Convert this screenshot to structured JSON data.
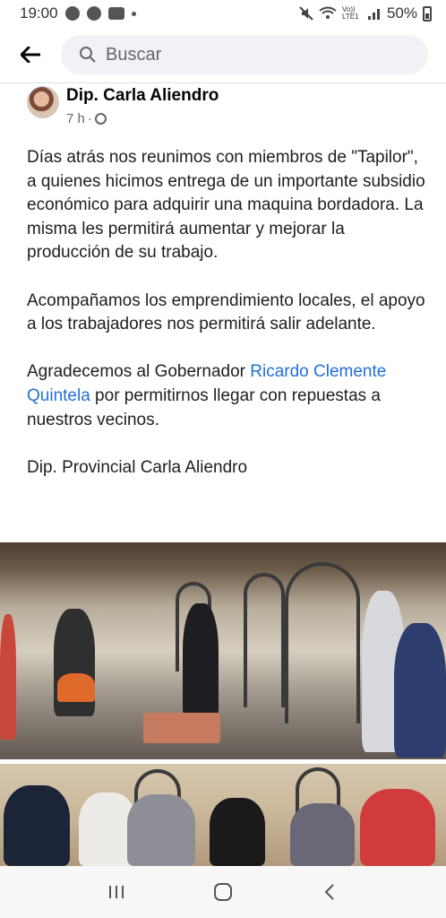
{
  "status_bar": {
    "time": "19:00",
    "network_label": "Vo)) LTE1",
    "battery": "50%"
  },
  "search": {
    "placeholder": "Buscar"
  },
  "post": {
    "author": "Dip. Carla Aliendro",
    "time": "7 h",
    "separator": "·",
    "paragraphs": {
      "p1": "Días atrás nos reunimos con miembros de \"Tapilor\", a quienes hicimos entrega de un importante subsidio económico para adquirir una maquina bordadora. La misma les permitirá aumentar y mejorar la producción de su trabajo.",
      "p2": "Acompañamos los emprendimiento locales, el apoyo a los trabajadores nos permitirá salir adelante.",
      "p3_before": "Agradecemos al Gobernador ",
      "p3_link": "Ricardo Clemente Quintela",
      "p3_after": " por permitirnos llegar con repuestas a nuestros vecinos.",
      "p4": "Dip. Provincial Carla Aliendro"
    }
  },
  "colors": {
    "link": "#216fdb",
    "text": "#1c1e21",
    "secondary": "#65676b"
  }
}
